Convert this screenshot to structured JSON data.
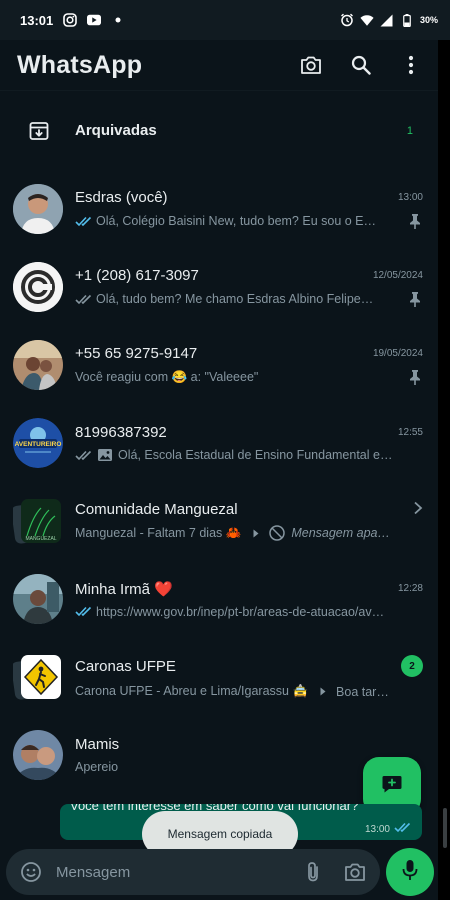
{
  "status": {
    "time": "13:01",
    "battery": "30%"
  },
  "header": {
    "title": "WhatsApp"
  },
  "archived": {
    "label": "Arquivadas",
    "count": "1"
  },
  "chats": [
    {
      "name": "Esdras (você)",
      "time": "13:00",
      "preview": "Olá, Colégio Baisini New, tudo bem? Eu sou o E…",
      "pinned": true,
      "ticks": "blue"
    },
    {
      "name": "+1 (208) 617-3097",
      "time": "12/05/2024",
      "preview": "Olá, tudo bem? Me chamo Esdras Albino  Felipe…",
      "pinned": true,
      "ticks": "grey"
    },
    {
      "name": "+55 65 9275-9147",
      "time": "19/05/2024",
      "preview": "Você reagiu com 😂 a: \"Valeeee\"",
      "pinned": true
    },
    {
      "name": "81996387392",
      "time": "12:55",
      "preview": "Olá, Escola Estadual de Ensino Fundamental e…",
      "ticks": "grey",
      "image_icon": true
    },
    {
      "name": "Comunidade Manguezal",
      "group": "Manguezal - Faltam 7 dias 🦀",
      "preview": "Mensagem apa…"
    },
    {
      "name": "Minha Irmã ❤️",
      "time": "12:28",
      "preview": "https://www.gov.br/inep/pt-br/areas-de-atuacao/av…",
      "ticks": "blue"
    },
    {
      "name": "Caronas UFPE",
      "group": "Carona UFPE - Abreu e Lima/Igarassu 🚖",
      "preview": "Boa tar…",
      "unread": "2"
    },
    {
      "name": "Mamis",
      "preview": "Apereio"
    }
  ],
  "overlay": {
    "bubble_text": "Você tem interesse em saber como vai funcionar?",
    "bubble_time": "13:00",
    "toast": "Mensagem copiada"
  },
  "composer": {
    "placeholder": "Mensagem"
  },
  "colors": {
    "accent": "#21c063",
    "background": "#0b141a",
    "tick_blue": "#53bdeb"
  }
}
